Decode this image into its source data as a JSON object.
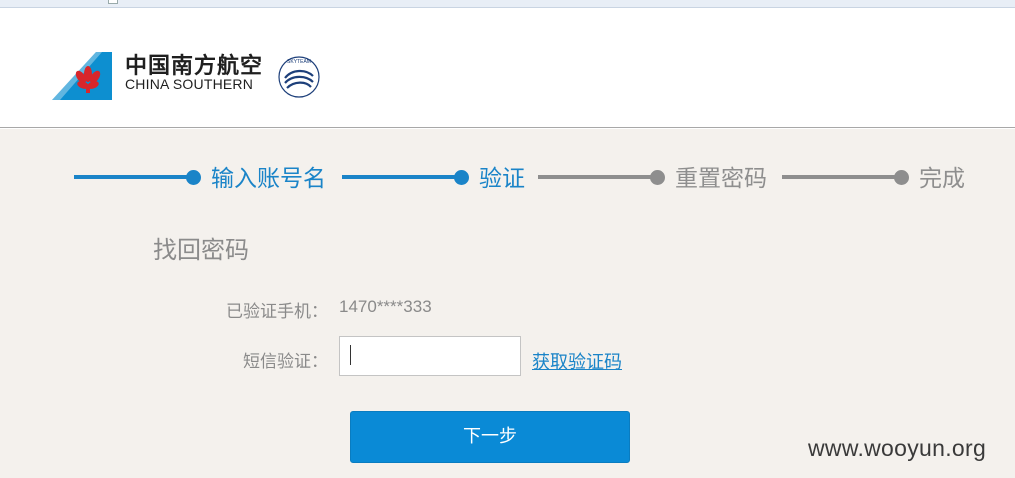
{
  "brand": {
    "name_cn": "中国南方航空",
    "name_en": "CHINA SOUTHERN",
    "alliance": "SKYTEAM",
    "logo_color": "#0d8fd0"
  },
  "steps": [
    {
      "label": "输入账号名",
      "state": "done"
    },
    {
      "label": "验证",
      "state": "current"
    },
    {
      "label": "重置密码",
      "state": "pending"
    },
    {
      "label": "完成",
      "state": "pending"
    }
  ],
  "colors": {
    "accent": "#1a84c8",
    "inactive": "#8e8e8e",
    "button": "#0a8ad6",
    "panel_bg": "#f4f1ed"
  },
  "form": {
    "title": "找回密码",
    "phone_label": "已验证手机：",
    "phone_value": "1470****333",
    "sms_label": "短信验证：",
    "sms_value": "",
    "get_code_link": "获取验证码",
    "next_button": "下一步"
  },
  "watermark": "www.wooyun.org"
}
